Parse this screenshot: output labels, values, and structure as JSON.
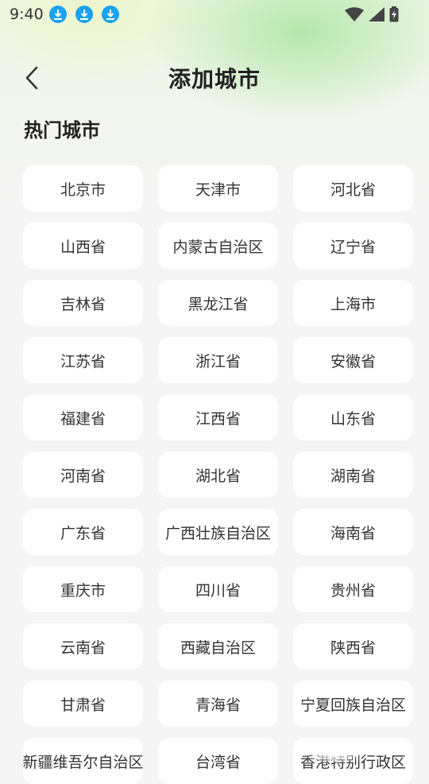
{
  "status_bar": {
    "time": "9:40",
    "download_icons": [
      "download-icon",
      "download-icon",
      "download-icon"
    ],
    "accent": "#1aa3f0"
  },
  "header": {
    "back_icon": "chevron-left-icon",
    "title": "添加城市"
  },
  "section": {
    "title": "热门城市"
  },
  "cities": [
    "北京市",
    "天津市",
    "河北省",
    "山西省",
    "内蒙古自治区",
    "辽宁省",
    "吉林省",
    "黑龙江省",
    "上海市",
    "江苏省",
    "浙江省",
    "安徽省",
    "福建省",
    "江西省",
    "山东省",
    "河南省",
    "湖北省",
    "湖南省",
    "广东省",
    "广西壮族自治区",
    "海南省",
    "重庆市",
    "四川省",
    "贵州省",
    "云南省",
    "西藏自治区",
    "陕西省",
    "甘肃省",
    "青海省",
    "宁夏回族自治区",
    "新疆维吾尔自治区",
    "台湾省",
    "香港特别行政区"
  ]
}
